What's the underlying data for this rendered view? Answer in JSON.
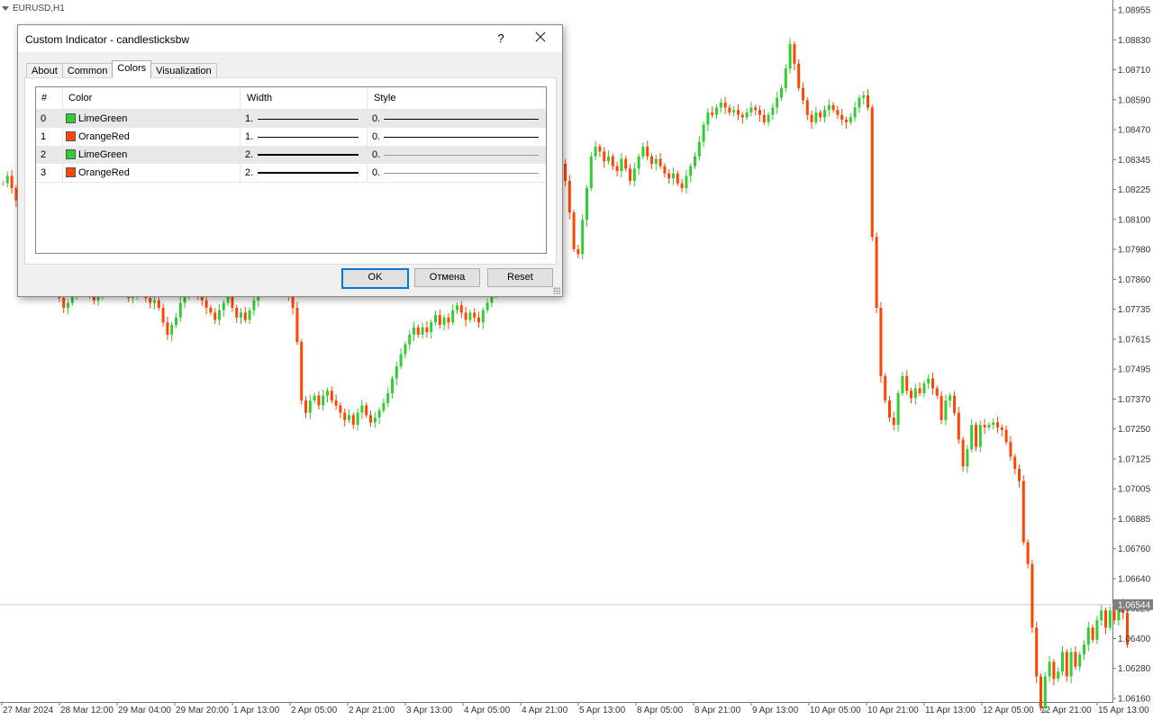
{
  "symbol_label": "EURUSD,H1",
  "colors": {
    "bull": "#32CD32",
    "bear": "#FF4500",
    "neutral": "#A9A9A9",
    "dialog_accent": "#0078d7"
  },
  "chart_data": {
    "type": "candlestick",
    "title": "EURUSD,H1",
    "y_ticks": [
      "1.08955",
      "1.08830",
      "1.08710",
      "1.08590",
      "1.08470",
      "1.08345",
      "1.08225",
      "1.08100",
      "1.07980",
      "1.07860",
      "1.07735",
      "1.07615",
      "1.07495",
      "1.07370",
      "1.07250",
      "1.07125",
      "1.07005",
      "1.06885",
      "1.06760",
      "1.06640",
      "1.06520",
      "1.06400",
      "1.06280",
      "1.06160"
    ],
    "ylim": [
      1.0616,
      1.0898
    ],
    "current_price_label": "1.06544",
    "current_price": 1.06544,
    "x_ticks": [
      "27 Mar 2024",
      "28 Mar 12:00",
      "29 Mar 04:00",
      "29 Mar 20:00",
      "1 Apr 13:00",
      "2 Apr 05:00",
      "2 Apr 21:00",
      "3 Apr 13:00",
      "4 Apr 05:00",
      "4 Apr 21:00",
      "5 Apr 13:00",
      "8 Apr 05:00",
      "8 Apr 21:00",
      "9 Apr 13:00",
      "10 Apr 05:00",
      "10 Apr 21:00",
      "11 Apr 13:00",
      "12 Apr 05:00",
      "12 Apr 21:00",
      "15 Apr 13:00"
    ],
    "closes": [
      1.0827,
      1.083,
      1.0825,
      1.082,
      1.0818,
      1.0822,
      1.0815,
      1.081,
      1.0806,
      1.08,
      1.0795,
      1.079,
      1.0785,
      1.078,
      1.0776,
      1.0778,
      1.0781,
      1.0784,
      1.0786,
      1.0784,
      1.0781,
      1.0779,
      1.0782,
      1.0785,
      1.0788,
      1.0792,
      1.0789,
      1.0786,
      1.0783,
      1.078,
      1.0782,
      1.0785,
      1.0783,
      1.078,
      1.0778,
      1.0779,
      1.0776,
      1.077,
      1.0765,
      1.0769,
      1.0772,
      1.0778,
      1.0782,
      1.0786,
      1.0784,
      1.0781,
      1.0779,
      1.0776,
      1.0774,
      1.0771,
      1.0775,
      1.0778,
      1.0781,
      1.0776,
      1.0772,
      1.0774,
      1.0771,
      1.0775,
      1.0779,
      1.0783,
      1.0787,
      1.079,
      1.0788,
      1.0785,
      1.0788,
      1.0784,
      1.0781,
      1.0776,
      1.0762,
      1.0738,
      1.0733,
      1.0738,
      1.074,
      1.0736,
      1.074,
      1.0742,
      1.0738,
      1.0736,
      1.0733,
      1.073,
      1.0732,
      1.0728,
      1.0733,
      1.0736,
      1.0732,
      1.0729,
      1.0731,
      1.0734,
      1.0737,
      1.0741,
      1.0747,
      1.0752,
      1.0757,
      1.0761,
      1.0765,
      1.0768,
      1.0765,
      1.0768,
      1.0766,
      1.077,
      1.0773,
      1.0769,
      1.0772,
      1.077,
      1.0775,
      1.0777,
      1.0774,
      1.0771,
      1.0774,
      1.0772,
      1.077,
      1.0775,
      1.0778,
      1.0782,
      1.0786,
      1.079,
      1.0794,
      1.0798,
      1.0802,
      1.0806,
      1.081,
      1.0814,
      1.0818,
      1.0822,
      1.0826,
      1.083,
      1.0834,
      1.0837,
      1.0839,
      1.0835,
      1.0828,
      1.0815,
      1.08,
      1.0798,
      1.0812,
      1.0825,
      1.0838,
      1.0842,
      1.084,
      1.0836,
      1.0838,
      1.0834,
      1.0832,
      1.0837,
      1.0833,
      1.0828,
      1.0833,
      1.0838,
      1.0842,
      1.0838,
      1.0835,
      1.0837,
      1.0834,
      1.0831,
      1.0829,
      1.0831,
      1.0827,
      1.0825,
      1.083,
      1.0834,
      1.0838,
      1.0844,
      1.0851,
      1.0856,
      1.0855,
      1.0858,
      1.086,
      1.0858,
      1.0856,
      1.0857,
      1.0855,
      1.0854,
      1.0856,
      1.0858,
      1.0857,
      1.0855,
      1.0852,
      1.0855,
      1.0858,
      1.0862,
      1.0866,
      1.0874,
      1.0884,
      1.0876,
      1.0866,
      1.0861,
      1.0855,
      1.0852,
      1.0856,
      1.0854,
      1.0857,
      1.0859,
      1.0857,
      1.0855,
      1.0853,
      1.0852,
      1.0854,
      1.0858,
      1.0862,
      1.0863,
      1.0858,
      1.0805,
      1.0776,
      1.0748,
      1.0738,
      1.0731,
      1.0728,
      1.0741,
      1.0748,
      1.0742,
      1.0739,
      1.0743,
      1.0741,
      1.0745,
      1.0747,
      1.0743,
      1.074,
      1.073,
      1.0738,
      1.074,
      1.0733,
      1.0722,
      1.0711,
      1.0718,
      1.0728,
      1.0719,
      1.0728,
      1.0727,
      1.0728,
      1.0729,
      1.0727,
      1.0726,
      1.0721,
      1.0715,
      1.071,
      1.0705,
      1.068,
      1.0671,
      1.0645,
      1.0625,
      1.0612,
      1.0625,
      1.0631,
      1.0624,
      1.0627,
      1.0635,
      1.0625,
      1.0635,
      1.0629,
      1.0634,
      1.0638,
      1.0645,
      1.064,
      1.0648,
      1.0652,
      1.0645,
      1.0652,
      1.0648,
      1.0655,
      1.0651,
      1.0638
    ]
  },
  "dialog": {
    "title": "Custom Indicator - candlesticksbw",
    "help_label": "?",
    "close_label": "✕",
    "tabs": [
      {
        "label": "About"
      },
      {
        "label": "Common"
      },
      {
        "label": "Colors"
      },
      {
        "label": "Visualization"
      }
    ],
    "columns": {
      "index": "#",
      "color": "Color",
      "width": "Width",
      "style": "Style"
    },
    "rows": [
      {
        "index": "0",
        "color_name": "LimeGreen",
        "color": "#32CD32",
        "width": "1.",
        "style": "0.",
        "line_width": 1,
        "style_line_width": 1
      },
      {
        "index": "1",
        "color_name": "OrangeRed",
        "color": "#FF4500",
        "width": "1.",
        "style": "0.",
        "line_width": 1,
        "style_line_width": 1
      },
      {
        "index": "2",
        "color_name": "LimeGreen",
        "color": "#32CD32",
        "width": "2.",
        "style": "0.",
        "line_width": 2,
        "style_line_width": 0.5
      },
      {
        "index": "3",
        "color_name": "OrangeRed",
        "color": "#FF4500",
        "width": "2.",
        "style": "0.",
        "line_width": 2,
        "style_line_width": 0.5
      }
    ],
    "buttons": {
      "ok": "OK",
      "cancel": "Отмена",
      "reset": "Reset"
    }
  }
}
